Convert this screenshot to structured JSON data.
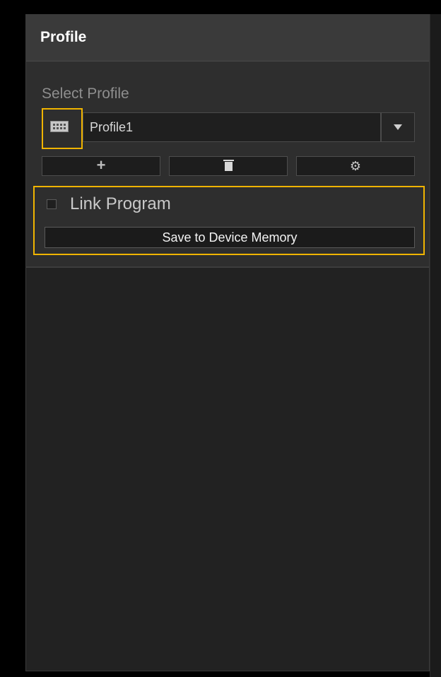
{
  "panel": {
    "title": "Profile"
  },
  "select_profile": {
    "label": "Select Profile",
    "current_value": "Profile1",
    "device_icon": "keyboard-icon",
    "dropdown_icon": "chevron-down-icon"
  },
  "actions": {
    "add_icon": "plus-icon",
    "add_symbol": "+",
    "delete_icon": "trash-icon",
    "settings_icon": "gear-icon",
    "settings_symbol": "⚙"
  },
  "link_program": {
    "label": "Link Program",
    "checked": false
  },
  "save": {
    "label": "Save to Device Memory"
  },
  "colors": {
    "highlight": "#f0b400",
    "panel_background": "#222222",
    "header_background": "#3a3a3a"
  }
}
